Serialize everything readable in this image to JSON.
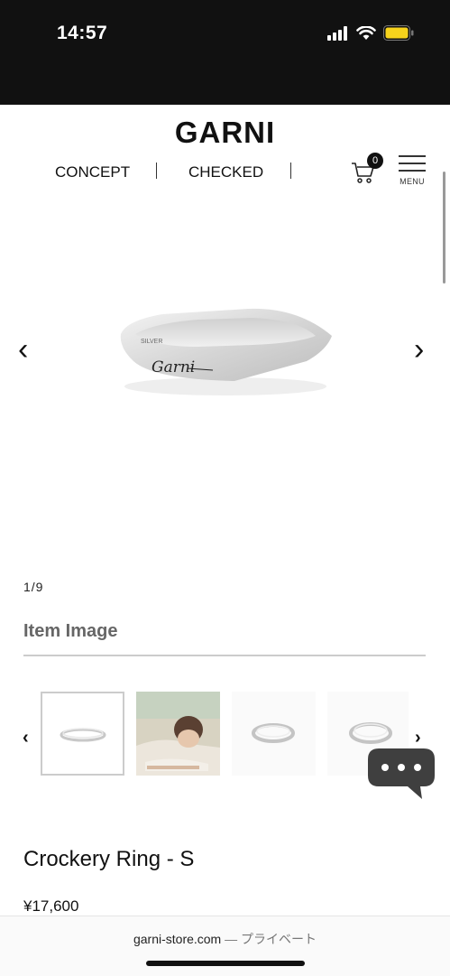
{
  "status_bar": {
    "time": "14:57"
  },
  "header": {
    "logo": "GARNI",
    "nav": [
      {
        "label": "CONCEPT"
      },
      {
        "label": "CHECKED"
      }
    ],
    "cart_count": "0",
    "menu_label": "MENU"
  },
  "product_image": {
    "prev_arrow": "‹",
    "next_arrow": "›",
    "engraving": "Garni",
    "counter": "1/9"
  },
  "gallery": {
    "title": "Item Image",
    "prev": "‹",
    "next": "›"
  },
  "product": {
    "name": "Crockery Ring - S",
    "price": "¥17,600"
  },
  "browser": {
    "host": "garni-store.com",
    "separator": " — ",
    "mode": "プライベート"
  }
}
